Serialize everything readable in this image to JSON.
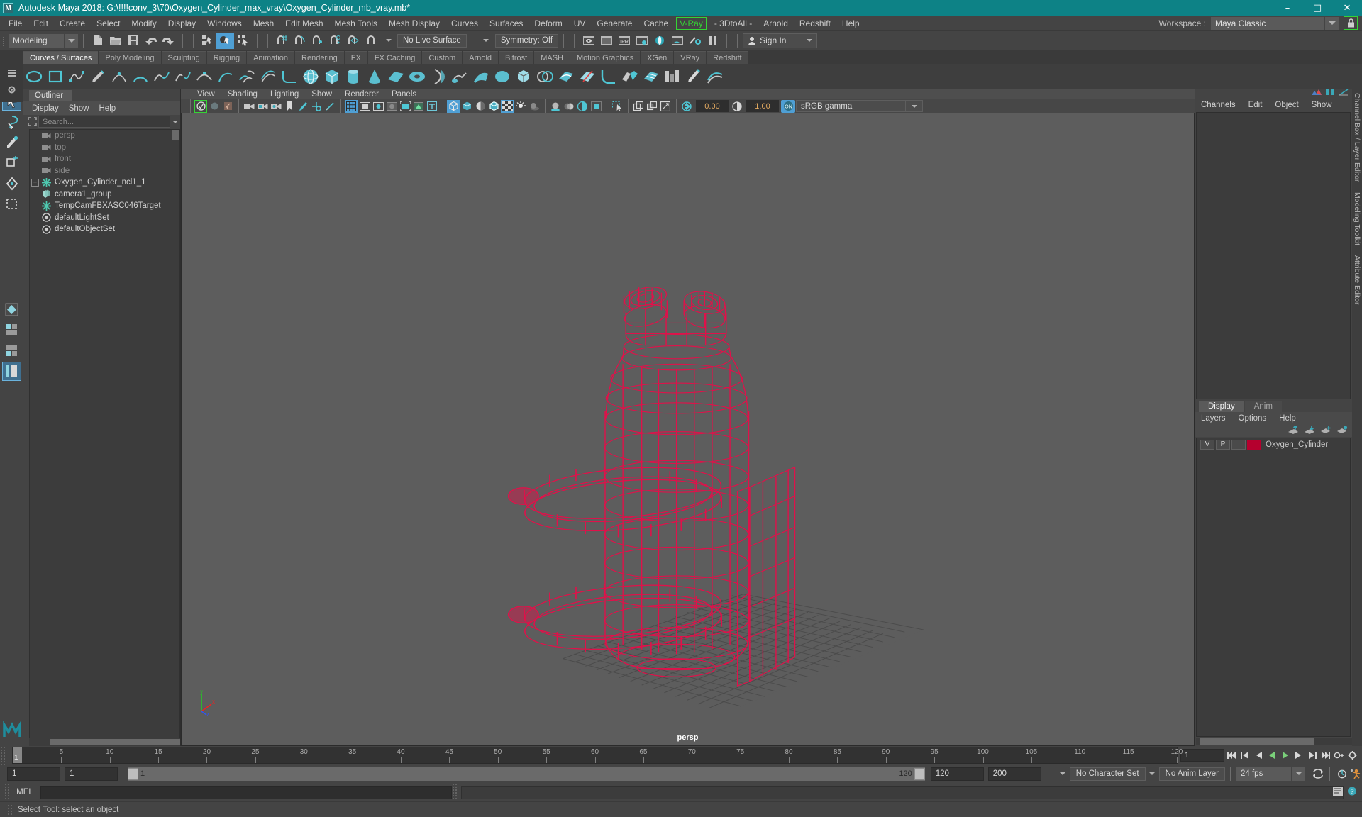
{
  "window": {
    "title": "Autodesk Maya 2018: G:\\!!!!conv_3\\70\\Oxygen_Cylinder_max_vray\\Oxygen_Cylinder_mb_vray.mb*",
    "logo": "M",
    "minimize": "–",
    "maximize": "□",
    "close": "✕",
    "titlebar_color": "#0d8286"
  },
  "menubar": {
    "items": [
      {
        "label": "File"
      },
      {
        "label": "Edit"
      },
      {
        "label": "Create"
      },
      {
        "label": "Select"
      },
      {
        "label": "Modify"
      },
      {
        "label": "Display"
      },
      {
        "label": "Windows"
      },
      {
        "label": "Mesh"
      },
      {
        "label": "Edit Mesh"
      },
      {
        "label": "Mesh Tools"
      },
      {
        "label": "Mesh Display"
      },
      {
        "label": "Curves"
      },
      {
        "label": "Surfaces"
      },
      {
        "label": "Deform"
      },
      {
        "label": "UV"
      },
      {
        "label": "Generate"
      },
      {
        "label": "Cache"
      },
      {
        "label": "V-Ray",
        "boxed": true
      },
      {
        "label": "- 3DtoAll -"
      },
      {
        "label": "Arnold"
      },
      {
        "label": "Redshift"
      },
      {
        "label": "Help"
      }
    ],
    "workspace_label": "Workspace :",
    "workspace_value": "Maya Classic",
    "lock_icon": "lock-icon"
  },
  "statusline": {
    "mode": "Modeling",
    "live_surface": "No Live Surface",
    "symmetry": "Symmetry: Off",
    "signin": "Sign In"
  },
  "shelf": {
    "tabs": [
      {
        "label": "Curves / Surfaces",
        "active": true
      },
      {
        "label": "Poly Modeling"
      },
      {
        "label": "Sculpting"
      },
      {
        "label": "Rigging"
      },
      {
        "label": "Animation"
      },
      {
        "label": "Rendering"
      },
      {
        "label": "FX"
      },
      {
        "label": "FX Caching"
      },
      {
        "label": "Custom"
      },
      {
        "label": "Arnold"
      },
      {
        "label": "Bifrost"
      },
      {
        "label": "MASH"
      },
      {
        "label": "Motion Graphics"
      },
      {
        "label": "XGen"
      },
      {
        "label": "VRay"
      },
      {
        "label": "Redshift"
      }
    ]
  },
  "outliner": {
    "tab": "Outliner",
    "menus": [
      "Display",
      "Show",
      "Help"
    ],
    "search_placeholder": "Search...",
    "items": [
      {
        "label": "persp",
        "icon": "camera-icon",
        "dim": true,
        "expand": false
      },
      {
        "label": "top",
        "icon": "camera-icon",
        "dim": true,
        "expand": false
      },
      {
        "label": "front",
        "icon": "camera-icon",
        "dim": true,
        "expand": false
      },
      {
        "label": "side",
        "icon": "camera-icon",
        "dim": true,
        "expand": false
      },
      {
        "label": "Oxygen_Cylinder_ncl1_1",
        "icon": "transform-icon",
        "dim": false,
        "expand": true
      },
      {
        "label": "camera1_group",
        "icon": "group-icon",
        "dim": false,
        "expand": false
      },
      {
        "label": "TempCamFBXASC046Target",
        "icon": "transform-icon",
        "dim": false,
        "expand": false
      },
      {
        "label": "defaultLightSet",
        "icon": "set-icon",
        "dim": false,
        "expand": false
      },
      {
        "label": "defaultObjectSet",
        "icon": "set-icon",
        "dim": false,
        "expand": false
      }
    ]
  },
  "viewport": {
    "menus": [
      "View",
      "Shading",
      "Lighting",
      "Show",
      "Renderer",
      "Panels"
    ],
    "exposure": "0.00",
    "gamma_value": "1.00",
    "color_space": "sRGB gamma",
    "camera_label": "persp",
    "wireframe_color": "#e0114a",
    "background_color": "#5d5d5d",
    "axis": {
      "x": "x",
      "y": "y",
      "z": "z"
    }
  },
  "channelbox": {
    "menus": [
      "Channels",
      "Edit",
      "Object",
      "Show"
    ],
    "vertical_tabs": [
      "Channel Box / Layer Editor",
      "Modeling Toolkit",
      "Attribute Editor"
    ]
  },
  "layers": {
    "tabs": [
      {
        "label": "Display",
        "active": true
      },
      {
        "label": "Anim",
        "active": false
      }
    ],
    "menus": [
      "Layers",
      "Options",
      "Help"
    ],
    "rows": [
      {
        "v": "V",
        "p": "P",
        "third": "",
        "color": "#b5002e",
        "name": "Oxygen_Cylinder"
      }
    ]
  },
  "timeline": {
    "current_frame": "1",
    "ticks": [
      5,
      10,
      15,
      20,
      25,
      30,
      35,
      40,
      45,
      50,
      55,
      60,
      65,
      70,
      75,
      80,
      85,
      90,
      95,
      100,
      105,
      110,
      115,
      120
    ],
    "end_field": "1"
  },
  "range": {
    "start": "1",
    "anim_start": "1",
    "slider_start": "1",
    "slider_end": "120",
    "anim_end": "120",
    "range_end": "200",
    "character_set": "No Character Set",
    "anim_layer": "No Anim Layer",
    "fps": "24 fps"
  },
  "command": {
    "label": "MEL",
    "input_value": ""
  },
  "statusbar": {
    "message": "Select Tool: select an object"
  }
}
